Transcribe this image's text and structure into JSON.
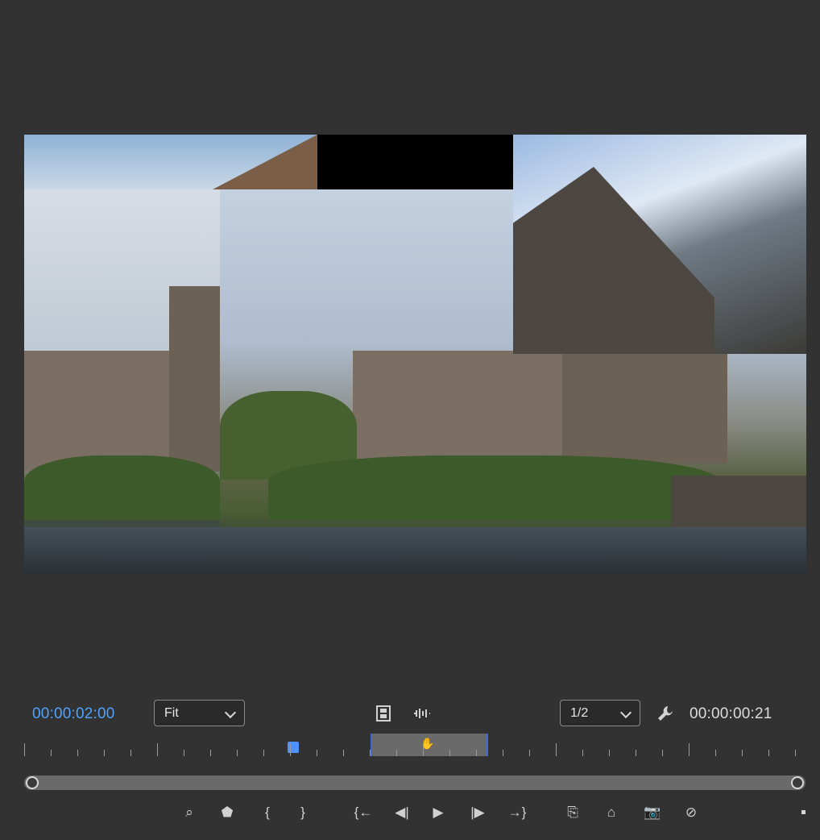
{
  "program_monitor": {
    "current_timecode": "00:00:02:00",
    "duration_timecode": "00:00:00:21",
    "zoom_select": {
      "value": "Fit"
    },
    "resolution_select": {
      "value": "1/2"
    },
    "icons": {
      "safe_margins": "filmstrip-icon",
      "audio": "audio-waveform-icon",
      "settings": "wrench-icon"
    }
  },
  "transport": {
    "buttons": [
      {
        "name": "export-frame-preview-button",
        "icon": "magnify-icon",
        "glyph": "⌕"
      },
      {
        "name": "add-marker-button",
        "icon": "marker-icon",
        "glyph": "⬟"
      },
      {
        "name": "mark-in-button",
        "icon": "brace-left-icon",
        "glyph": "{"
      },
      {
        "name": "mark-out-button",
        "icon": "brace-right-icon",
        "glyph": "}"
      },
      {
        "name": "go-to-in-button",
        "icon": "go-to-in-icon",
        "glyph": "{←"
      },
      {
        "name": "step-back-button",
        "icon": "step-back-icon",
        "glyph": "◀|"
      },
      {
        "name": "play-button",
        "icon": "play-icon",
        "glyph": "▶"
      },
      {
        "name": "step-forward-button",
        "icon": "step-forward-icon",
        "glyph": "|▶"
      },
      {
        "name": "go-to-out-button",
        "icon": "go-to-out-icon",
        "glyph": "→}"
      },
      {
        "name": "insert-button",
        "icon": "insert-icon",
        "glyph": "⎘"
      },
      {
        "name": "overwrite-button",
        "icon": "overwrite-icon",
        "glyph": "⌂"
      },
      {
        "name": "export-frame-button",
        "icon": "camera-icon",
        "glyph": "📷"
      },
      {
        "name": "multicam-button",
        "icon": "multicam-icon",
        "glyph": "⊘"
      }
    ]
  },
  "scrubber": {
    "playhead_position": 0.34,
    "work_area_start": 0.447,
    "work_area_end": 0.597
  }
}
